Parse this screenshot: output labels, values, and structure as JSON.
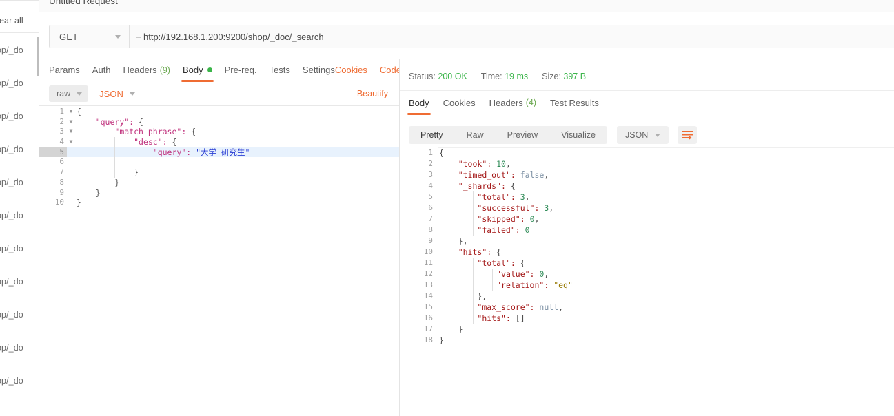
{
  "sidebar": {
    "clear_all_label": "Clear all",
    "history_items": [
      {
        "label": "op/_do"
      },
      {
        "label": "op/_do"
      },
      {
        "label": "op/_do"
      },
      {
        "label": "op/_do"
      },
      {
        "label": "op/_do"
      },
      {
        "label": "op/_do"
      },
      {
        "label": "op/_do"
      },
      {
        "label": "op/_do"
      },
      {
        "label": "op/_do"
      },
      {
        "label": "op/_do"
      },
      {
        "label": "op/_do"
      }
    ]
  },
  "request": {
    "tab_title": "Untitled Request",
    "method": "GET",
    "url": "http://192.168.1.200:9200/shop/_doc/_search",
    "tabs": [
      {
        "label": "Params",
        "count": "",
        "active": false,
        "dot": false,
        "link": false
      },
      {
        "label": "Auth",
        "count": "",
        "active": false,
        "dot": false,
        "link": false
      },
      {
        "label": "Headers",
        "count": "(9)",
        "active": false,
        "dot": false,
        "link": false
      },
      {
        "label": "Body",
        "count": "",
        "active": true,
        "dot": true,
        "link": false
      },
      {
        "label": "Pre-req.",
        "count": "",
        "active": false,
        "dot": false,
        "link": false
      },
      {
        "label": "Tests",
        "count": "",
        "active": false,
        "dot": false,
        "link": false
      },
      {
        "label": "Settings",
        "count": "",
        "active": false,
        "dot": false,
        "link": false
      },
      {
        "label": "Cookies",
        "count": "",
        "active": false,
        "dot": false,
        "link": true
      },
      {
        "label": "Code",
        "count": "",
        "active": false,
        "dot": false,
        "link": true
      }
    ],
    "body_mode": "raw",
    "body_format": "JSON",
    "beautify_label": "Beautify",
    "body_lines": [
      {
        "n": "1",
        "fold": true,
        "active": false,
        "text": "{"
      },
      {
        "n": "2",
        "fold": true,
        "active": false,
        "text": "    \"query\": {"
      },
      {
        "n": "3",
        "fold": true,
        "active": false,
        "text": "        \"match_phrase\": {"
      },
      {
        "n": "4",
        "fold": true,
        "active": false,
        "text": "            \"desc\": {"
      },
      {
        "n": "5",
        "fold": false,
        "active": true,
        "text": "                \"query\": \"大学 研究生\""
      },
      {
        "n": "6",
        "fold": false,
        "active": false,
        "text": ""
      },
      {
        "n": "7",
        "fold": false,
        "active": false,
        "text": "            }"
      },
      {
        "n": "8",
        "fold": false,
        "active": false,
        "text": "        }"
      },
      {
        "n": "9",
        "fold": false,
        "active": false,
        "text": "    }"
      },
      {
        "n": "10",
        "fold": false,
        "active": false,
        "text": "}"
      }
    ]
  },
  "response": {
    "status_label": "Status:",
    "status_value": "200 OK",
    "time_label": "Time:",
    "time_value": "19 ms",
    "size_label": "Size:",
    "size_value": "397 B",
    "tabs": [
      {
        "label": "Body",
        "count": "",
        "active": true
      },
      {
        "label": "Cookies",
        "count": "",
        "active": false
      },
      {
        "label": "Headers",
        "count": "(4)",
        "active": false
      },
      {
        "label": "Test Results",
        "count": "",
        "active": false
      }
    ],
    "view_modes": [
      {
        "label": "Pretty",
        "active": true
      },
      {
        "label": "Raw",
        "active": false
      },
      {
        "label": "Preview",
        "active": false
      },
      {
        "label": "Visualize",
        "active": false
      }
    ],
    "format": "JSON",
    "body_lines": [
      {
        "n": "1",
        "text": "{"
      },
      {
        "n": "2",
        "text": "    \"took\": 10,"
      },
      {
        "n": "3",
        "text": "    \"timed_out\": false,"
      },
      {
        "n": "4",
        "text": "    \"_shards\": {"
      },
      {
        "n": "5",
        "text": "        \"total\": 3,"
      },
      {
        "n": "6",
        "text": "        \"successful\": 3,"
      },
      {
        "n": "7",
        "text": "        \"skipped\": 0,"
      },
      {
        "n": "8",
        "text": "        \"failed\": 0"
      },
      {
        "n": "9",
        "text": "    },"
      },
      {
        "n": "10",
        "text": "    \"hits\": {"
      },
      {
        "n": "11",
        "text": "        \"total\": {"
      },
      {
        "n": "12",
        "text": "            \"value\": 0,"
      },
      {
        "n": "13",
        "text": "            \"relation\": \"eq\""
      },
      {
        "n": "14",
        "text": "        },"
      },
      {
        "n": "15",
        "text": "        \"max_score\": null,"
      },
      {
        "n": "16",
        "text": "        \"hits\": []"
      },
      {
        "n": "17",
        "text": "    }"
      },
      {
        "n": "18",
        "text": "}"
      }
    ]
  },
  "colors": {
    "accent": "#ef6c33",
    "success": "#3bb54a",
    "json_key": "#a31515",
    "json_number": "#2e8b57",
    "json_string": "#9a7d0a"
  }
}
